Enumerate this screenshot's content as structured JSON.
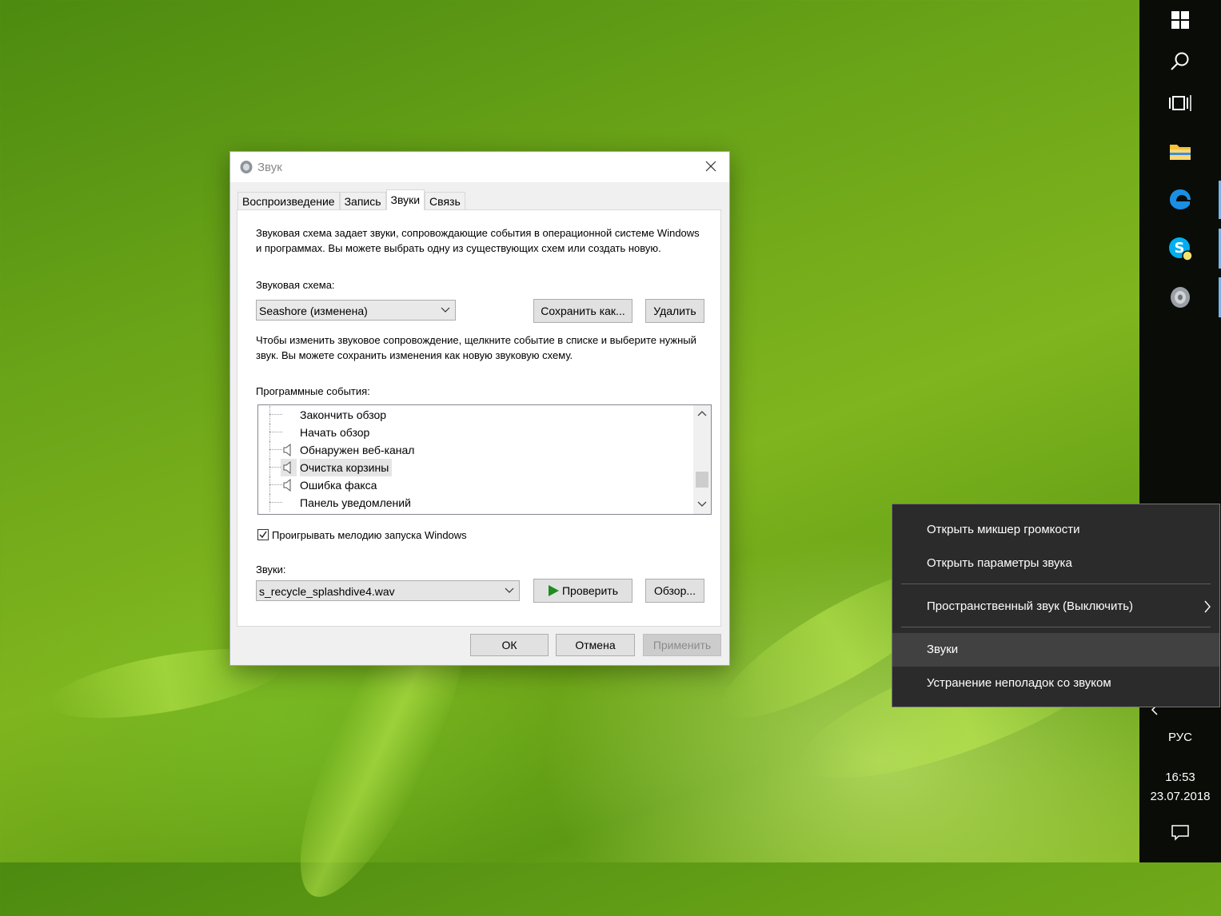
{
  "dialog": {
    "title": "Звук",
    "tabs": [
      {
        "label": "Воспроизведение",
        "active": false
      },
      {
        "label": "Запись",
        "active": false
      },
      {
        "label": "Звуки",
        "active": true
      },
      {
        "label": "Связь",
        "active": false
      }
    ],
    "description": "Звуковая схема задает звуки, сопровождающие события в операционной системе Windows и программах. Вы можете выбрать одну из существующих схем или создать новую.",
    "scheme_label": "Звуковая схема:",
    "scheme_value": "Seashore (изменена)",
    "save_as_label": "Сохранить как...",
    "delete_label": "Удалить",
    "instructions": "Чтобы изменить звуковое сопровождение, щелкните событие в списке и выберите нужный звук. Вы можете сохранить изменения как новую звуковую схему.",
    "events_label": "Программные события:",
    "events": [
      {
        "label": "Закончить обзор",
        "has_sound": false,
        "selected": false
      },
      {
        "label": "Начать обзор",
        "has_sound": false,
        "selected": false
      },
      {
        "label": "Обнаружен веб-канал",
        "has_sound": true,
        "selected": false
      },
      {
        "label": "Очистка корзины",
        "has_sound": true,
        "selected": true
      },
      {
        "label": "Ошибка факса",
        "has_sound": true,
        "selected": false
      },
      {
        "label": "Панель уведомлений",
        "has_sound": false,
        "selected": false
      }
    ],
    "startup_checkbox_label": "Проигрывать мелодию запуска Windows",
    "startup_checked": true,
    "sounds_label": "Звуки:",
    "sound_file": "s_recycle_splashdive4.wav",
    "test_label": "Проверить",
    "browse_label": "Обзор...",
    "ok_label": "ОК",
    "cancel_label": "Отмена",
    "apply_label": "Применить"
  },
  "context_menu": {
    "items": [
      {
        "label": "Открыть микшер громкости"
      },
      {
        "label": "Открыть параметры звука"
      },
      {
        "label": "Пространственный звук (Выключить)"
      },
      {
        "label": "Звуки"
      },
      {
        "label": "Устранение неполадок со звуком"
      }
    ]
  },
  "taskbar": {
    "language": "РУС",
    "time": "16:53",
    "date": "23.07.2018",
    "icons": [
      "windows-start-icon",
      "search-icon",
      "task-view-icon",
      "file-explorer-icon",
      "edge-icon",
      "skype-icon",
      "speaker-icon"
    ]
  },
  "colors": {
    "taskbar_bg": "#0a0c08",
    "menu_bg": "#2b2b2b",
    "menu_hover": "#414141",
    "accent": "#0078d7"
  }
}
